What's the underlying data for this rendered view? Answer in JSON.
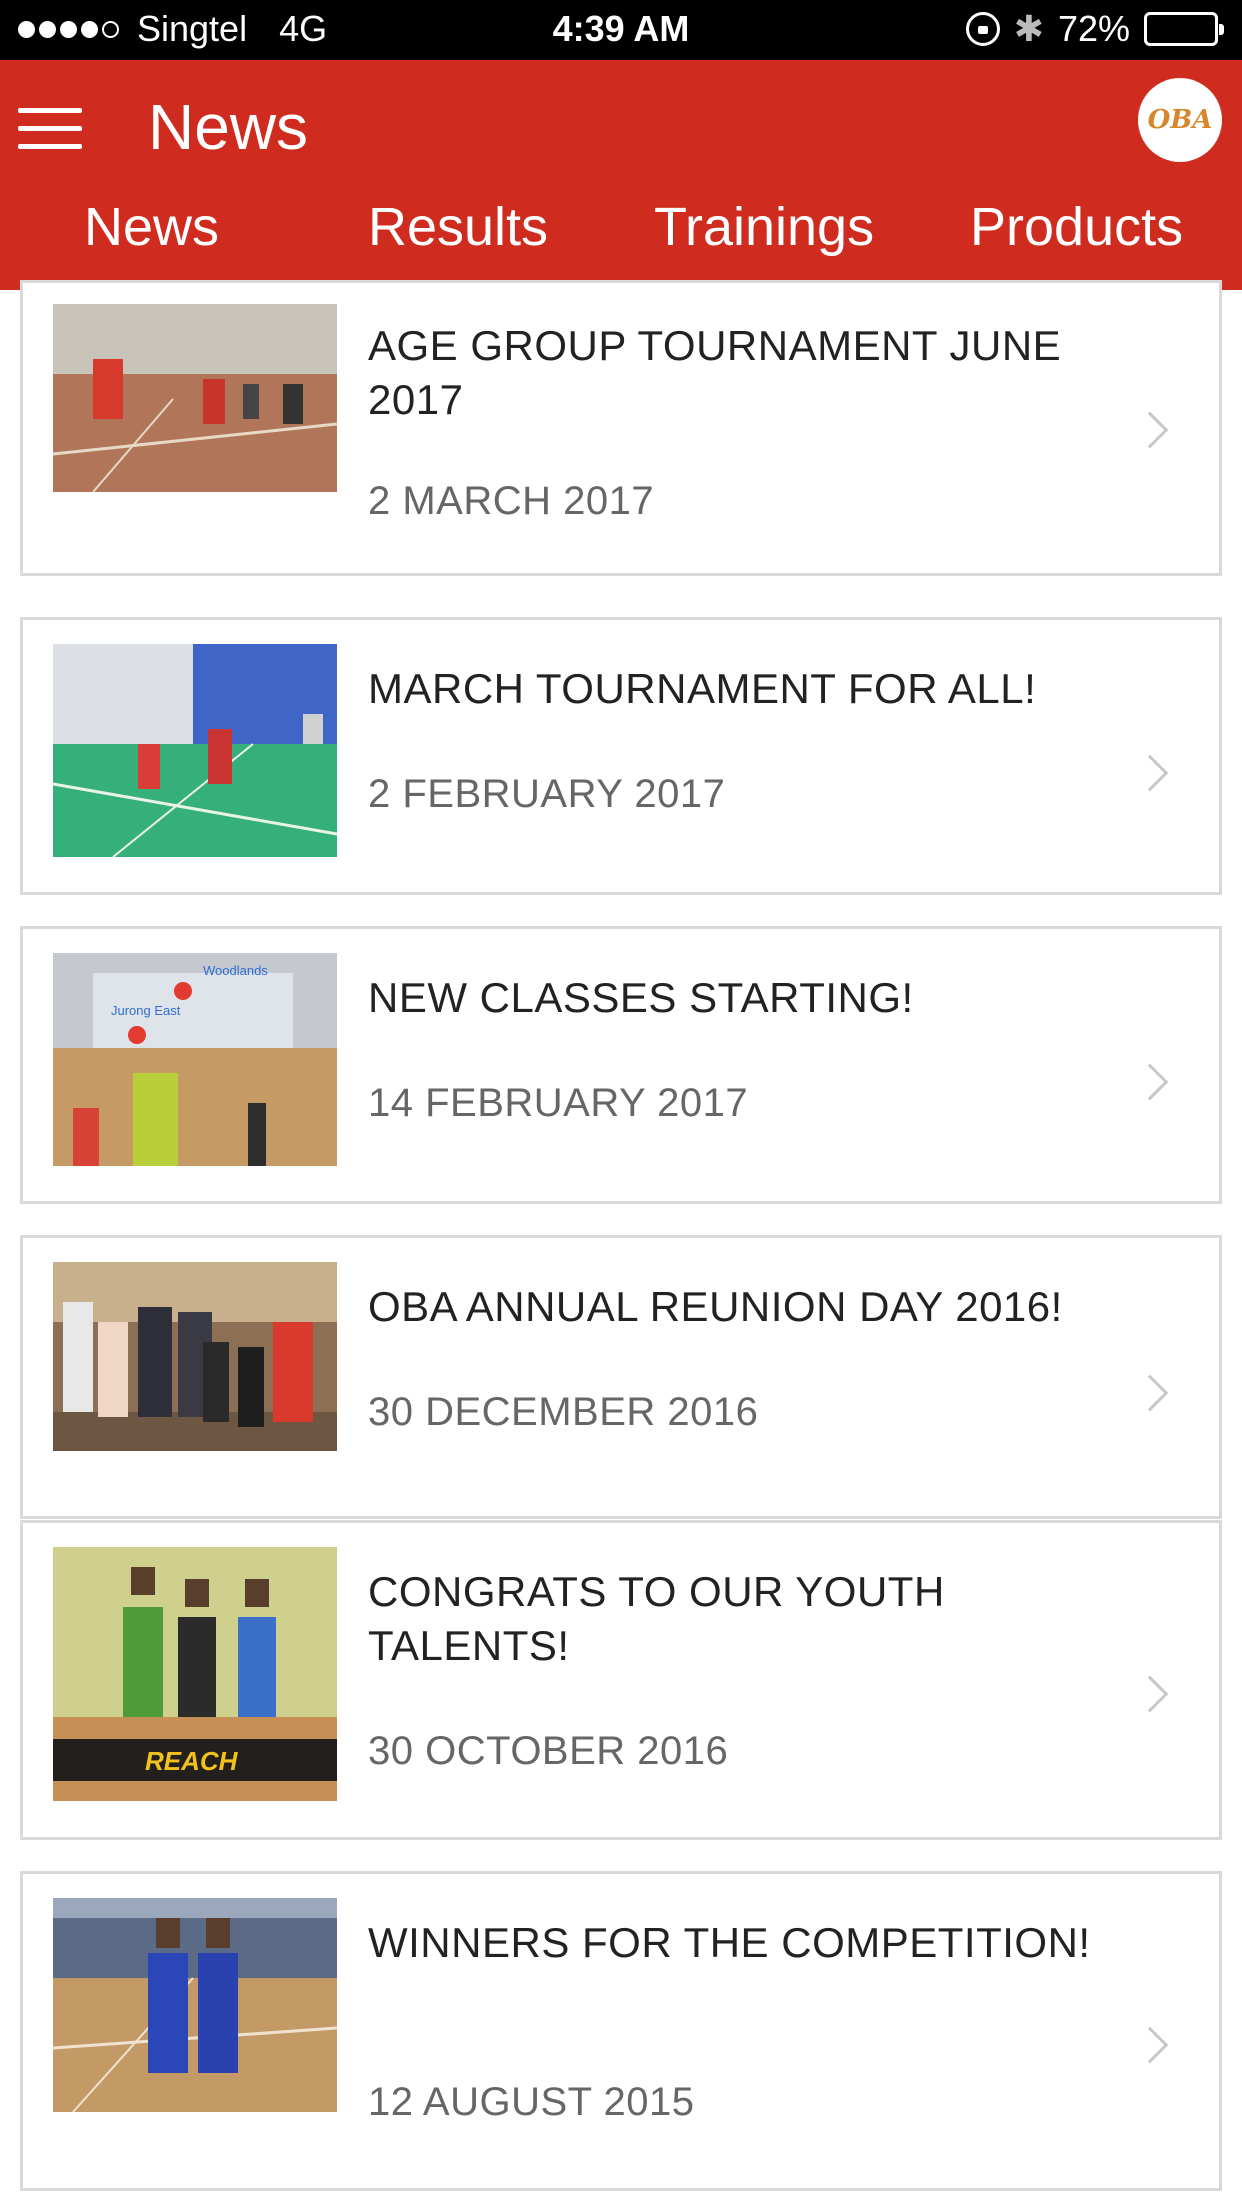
{
  "status_bar": {
    "carrier": "Singtel",
    "network": "4G",
    "time": "4:39 AM",
    "battery_text": "72%",
    "battery_level": 0.72,
    "signal_bars_filled": 4,
    "signal_bars_total": 5
  },
  "header": {
    "title": "News",
    "logo_text": "OBA",
    "accent_color": "#cf2c1f"
  },
  "tabs": [
    {
      "label": "News"
    },
    {
      "label": "Results"
    },
    {
      "label": "Trainings"
    },
    {
      "label": "Products"
    }
  ],
  "news": [
    {
      "title": "AGE GROUP TOURNAMENT JUNE 2017",
      "date": "2 MARCH 2017"
    },
    {
      "title": "MARCH TOURNAMENT FOR ALL!",
      "date": "2 FEBRUARY 2017"
    },
    {
      "title": "NEW CLASSES STARTING!",
      "date": "14 FEBRUARY 2017",
      "thumbnail_map_labels": [
        "Woodlands",
        "Jurong East"
      ]
    },
    {
      "title": "OBA ANNUAL REUNION DAY 2016!",
      "date": "30 DECEMBER 2016"
    },
    {
      "title": "CONGRATS TO OUR YOUTH TALENTS!",
      "date": "30 OCTOBER 2016",
      "thumbnail_banner_text": "REACH"
    },
    {
      "title": "WINNERS FOR THE COMPETITION!",
      "date": "12 AUGUST 2015"
    }
  ]
}
